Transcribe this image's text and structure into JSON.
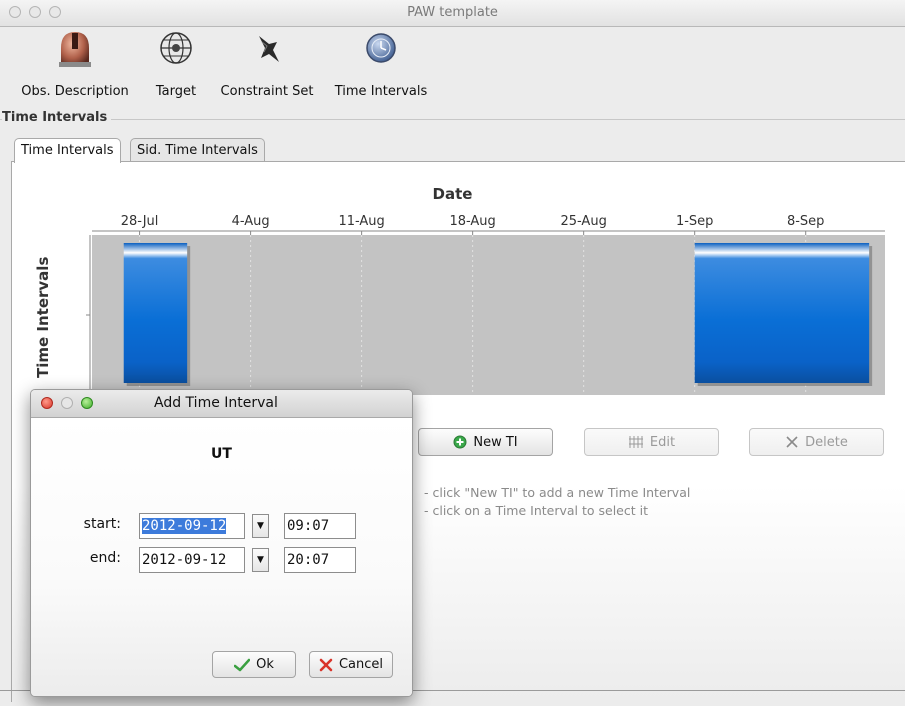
{
  "window": {
    "title": "PAW template"
  },
  "toolbar": {
    "items": [
      {
        "label": "Obs. Description",
        "icon": "observatory-icon"
      },
      {
        "label": "Target",
        "icon": "globe-target-icon"
      },
      {
        "label": "Constraint Set",
        "icon": "constraint-icon"
      },
      {
        "label": "Time Intervals",
        "icon": "clock-icon"
      }
    ]
  },
  "section": {
    "title": "Time Intervals"
  },
  "tabs": [
    {
      "label": "Time Intervals",
      "active": true
    },
    {
      "label": "Sid. Time Intervals",
      "active": false
    }
  ],
  "chart_data": {
    "type": "timeline",
    "title": "Date",
    "ylabel": "Time Intervals",
    "ticks": [
      "28-Jul",
      "4-Aug",
      "11-Aug",
      "18-Aug",
      "25-Aug",
      "1-Sep",
      "8-Sep"
    ],
    "x_range": [
      "2012-07-25",
      "2012-09-13"
    ],
    "intervals": [
      {
        "start": "2012-07-27",
        "end": "2012-07-31"
      },
      {
        "start": "2012-09-01",
        "end": "2012-09-12"
      }
    ],
    "colors": {
      "plot_bg": "#c3c3c3",
      "bar": "#0a66c8"
    }
  },
  "actions": {
    "new_ti": "New TI",
    "edit": "Edit",
    "delete": "Delete"
  },
  "hints": [
    "- click \"New TI\" to add a new Time Interval",
    "- click on a Time Interval to select it"
  ],
  "dialog": {
    "title": "Add Time Interval",
    "timezone": "UT",
    "start_label": "start:",
    "end_label": "end:",
    "start_date": "2012-09-12",
    "start_time": "09:07",
    "end_date": "2012-09-12",
    "end_time": "20:07",
    "ok": "Ok",
    "cancel": "Cancel"
  }
}
